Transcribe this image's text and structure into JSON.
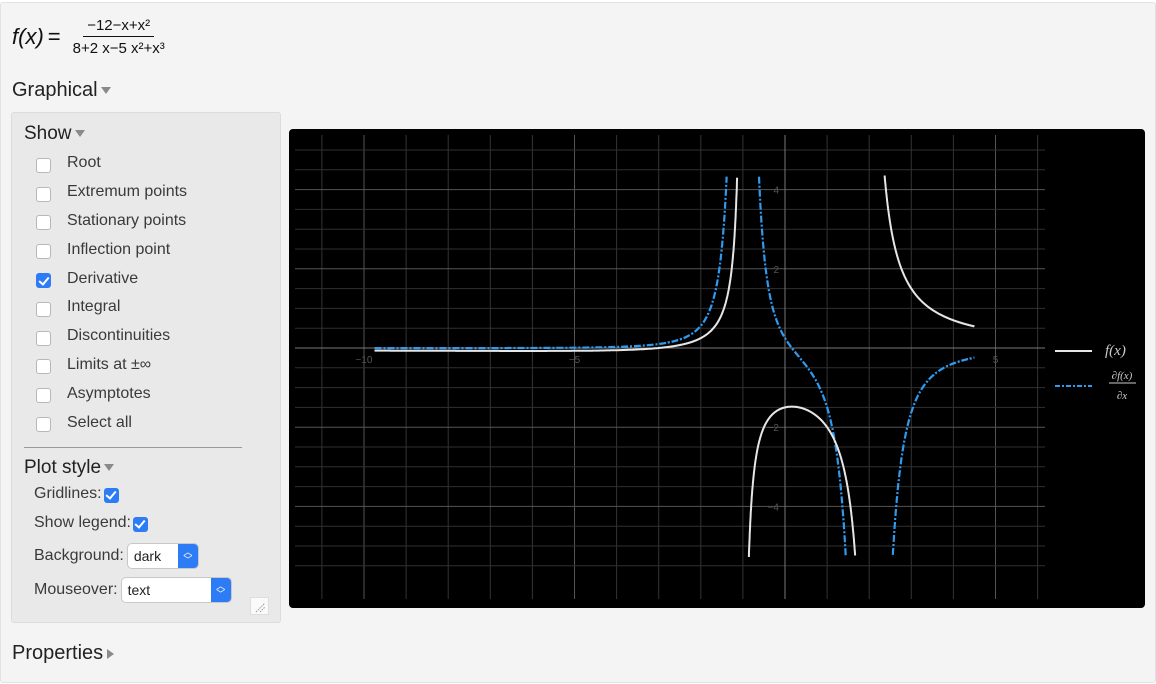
{
  "formula": {
    "lhs": "f(x)",
    "equals": "=",
    "numerator": "−12−x+x²",
    "denominator": "8+2 x−5 x²+x³"
  },
  "sections": {
    "graphical": "Graphical",
    "properties": "Properties"
  },
  "show": {
    "title": "Show",
    "items": [
      {
        "label": "Root",
        "checked": false
      },
      {
        "label": "Extremum points",
        "checked": false
      },
      {
        "label": "Stationary points",
        "checked": false
      },
      {
        "label": "Inflection point",
        "checked": false
      },
      {
        "label": "Derivative",
        "checked": true
      },
      {
        "label": "Integral",
        "checked": false
      },
      {
        "label": "Discontinuities",
        "checked": false
      },
      {
        "label": "Limits at ±∞",
        "checked": false
      },
      {
        "label": "Asymptotes",
        "checked": false
      },
      {
        "label": "Select all",
        "checked": false
      }
    ]
  },
  "plot_style": {
    "title": "Plot style",
    "gridlines_label": "Gridlines:",
    "gridlines": true,
    "legend_label": "Show legend:",
    "legend": true,
    "background_label": "Background:",
    "background_value": "dark",
    "mouseover_label": "Mouseover:",
    "mouseover_value": "text"
  },
  "colors": {
    "accent": "#2d7cf6",
    "plot_bg": "#000000",
    "f_line": "#e6e6e6",
    "df_line": "#2e9bf0"
  },
  "chart_data": {
    "type": "line",
    "title": "",
    "xlabel": "",
    "ylabel": "",
    "function": "(x^2 - x - 12)/(x^3 - 5x^2 + 2x + 8)",
    "x_range": [
      -9.75,
      4.5
    ],
    "view_xlim": [
      -11.5,
      6.2
    ],
    "view_ylim": [
      -5.8,
      5.4
    ],
    "clip_ylim": [
      -5.3,
      4.4
    ],
    "xticks": [
      {
        "value": -10,
        "label": "−10"
      },
      {
        "value": -5,
        "label": "−5"
      },
      {
        "value": 5,
        "label": "5"
      }
    ],
    "yticks": [
      {
        "value": 4,
        "label": "4"
      },
      {
        "value": 2,
        "label": "2"
      },
      {
        "value": -2,
        "label": "−2"
      },
      {
        "value": -4,
        "label": "−4"
      }
    ],
    "grid": true,
    "grid_x_step": 1,
    "grid_y_step": 0.5,
    "poles": [
      -1,
      2
    ],
    "series": [
      {
        "name": "f(x)",
        "style": "solid",
        "color": "#e6e6e6"
      },
      {
        "name": "∂f(x)/∂x",
        "style": "dash-dot",
        "color": "#2e9bf0"
      }
    ],
    "legend": {
      "placement": "right",
      "entries": [
        {
          "label": "f(x)"
        },
        {
          "label_num": "∂f(x)",
          "label_den": "∂x"
        }
      ]
    }
  }
}
